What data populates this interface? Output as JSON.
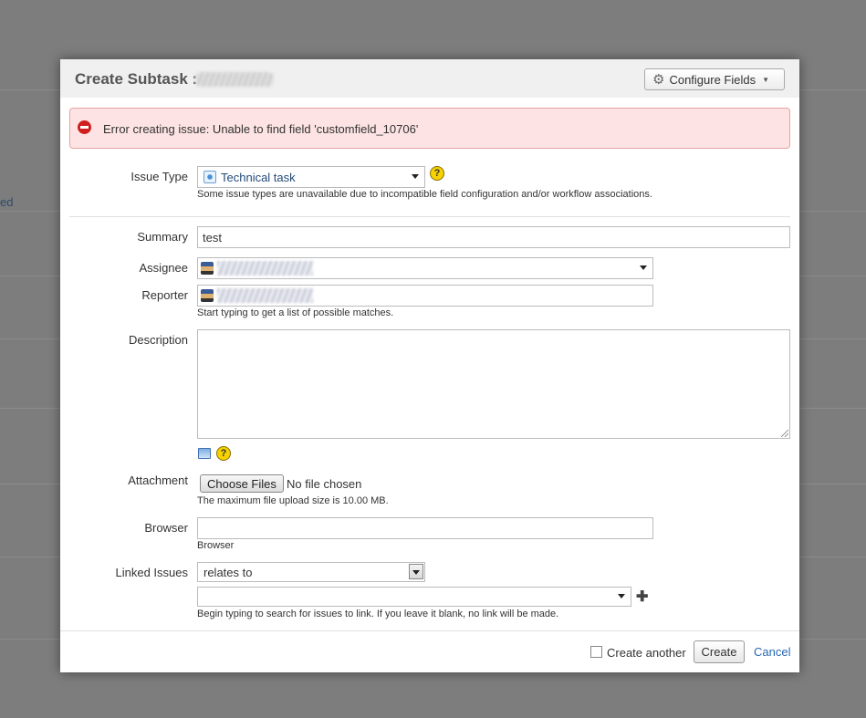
{
  "background": {
    "link_fragment": "ed"
  },
  "dialog": {
    "title": "Create Subtask :",
    "configure_fields_label": "Configure Fields",
    "error_message": "Error creating issue: Unable to find field 'customfield_10706'"
  },
  "fields": {
    "issue_type": {
      "label": "Issue Type",
      "value": "Technical task",
      "hint": "Some issue types are unavailable due to incompatible field configuration and/or workflow associations."
    },
    "summary": {
      "label": "Summary",
      "value": "test"
    },
    "assignee": {
      "label": "Assignee"
    },
    "reporter": {
      "label": "Reporter",
      "hint": "Start typing to get a list of possible matches."
    },
    "description": {
      "label": "Description",
      "value": ""
    },
    "attachment": {
      "label": "Attachment",
      "button_label": "Choose Files",
      "status": "No file chosen",
      "hint": "The maximum file upload size is 10.00 MB."
    },
    "browser": {
      "label": "Browser",
      "value": "",
      "hint": "Browser"
    },
    "linked_issues": {
      "label": "Linked Issues",
      "relation": "relates to",
      "issue_value": "",
      "hint": "Begin typing to search for issues to link. If you leave it blank, no link will be made."
    }
  },
  "footer": {
    "create_another_label": "Create another",
    "create_label": "Create",
    "cancel_label": "Cancel"
  },
  "icons": {
    "help": "?",
    "gear": "⚙",
    "plus": "✚"
  },
  "colors": {
    "error_bg": "#fde3e3",
    "error_border": "#e7a3a3",
    "link": "#2a68b1"
  }
}
